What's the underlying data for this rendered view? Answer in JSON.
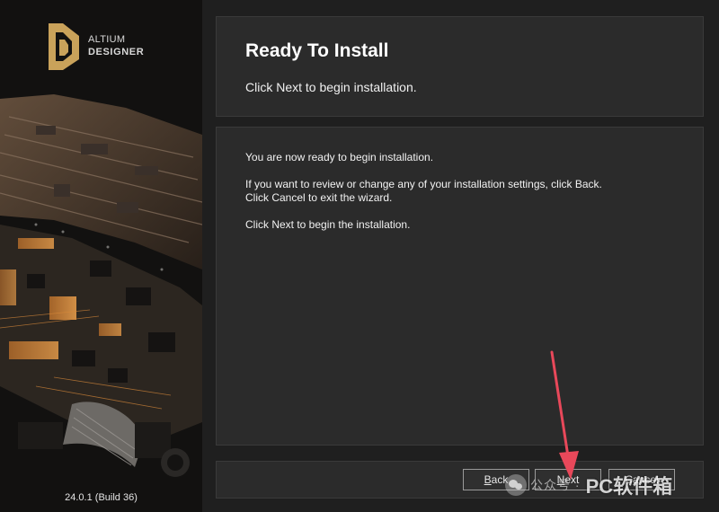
{
  "branding": {
    "logo_line1": "ALTIUM",
    "logo_line2": "DESIGNER",
    "version": "24.0.1 (Build 36)"
  },
  "header": {
    "title": "Ready To Install",
    "subtitle": "Click Next to begin installation."
  },
  "body": {
    "line1": "You are now ready to begin installation.",
    "line2": "If you want to review or change any of your installation settings, click Back.",
    "line3": "Click Cancel to exit the wizard.",
    "line4": "Click Next to begin the installation."
  },
  "buttons": {
    "back": {
      "mnemonic": "B",
      "rest": "ack"
    },
    "next": {
      "mnemonic": "N",
      "rest": "ext"
    },
    "cancel": {
      "label": "Cancel"
    }
  },
  "watermark": {
    "small": "公众号 ·",
    "big": "PC软件箱"
  },
  "colors": {
    "background": "#1f1f1f",
    "panel": "#2b2b2b",
    "accent_logo": "#c9a25a",
    "annotation_arrow": "#e8485a"
  }
}
